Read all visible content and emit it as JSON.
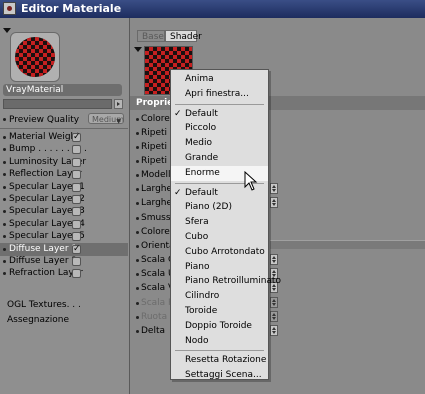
{
  "window": {
    "title": "Editor Materiale"
  },
  "left_panel": {
    "material_name": "VrayMaterial",
    "preview_quality_label": "Preview Quality",
    "preview_quality_value": "Medium",
    "channels": [
      {
        "label": "Material Weight",
        "checked": true,
        "checked_mark": "✓"
      },
      {
        "label": "Bump . . . . . . . . .",
        "checked": false
      },
      {
        "label": "Luminosity Layer",
        "checked": false
      },
      {
        "label": "Reflection Layer",
        "checked": false
      },
      {
        "label": "Specular Layer 1",
        "checked": false
      },
      {
        "label": "Specular Layer 2",
        "checked": false
      },
      {
        "label": "Specular Layer 3",
        "checked": false
      },
      {
        "label": "Specular Layer 4",
        "checked": false
      },
      {
        "label": "Specular Layer 5",
        "checked": false
      },
      {
        "label": "Diffuse Layer 1",
        "checked": true,
        "checked_mark": "✓",
        "selected": true
      },
      {
        "label": "Diffuse Layer 2",
        "checked": false
      },
      {
        "label": "Refraction Layer",
        "checked": false
      }
    ],
    "extra_items": [
      "OGL Textures. . .",
      "Assegnazione"
    ]
  },
  "right_panel": {
    "tabs": [
      {
        "label": "Base",
        "active": false
      },
      {
        "label": "Shader",
        "active": true
      }
    ],
    "properties_header": "Propriet",
    "properties": [
      {
        "label": "Colore S"
      },
      {
        "label": "Ripeti C"
      },
      {
        "label": "Ripeti C"
      },
      {
        "label": "Ripeti C"
      },
      {
        "label": "Modello"
      },
      {
        "label": "Larghez"
      },
      {
        "label": "Larghez"
      },
      {
        "label": "Smussa"
      },
      {
        "label": "Colore C"
      },
      {
        "label": "Orientar"
      },
      {
        "label": "Scala G"
      },
      {
        "label": "Scala U"
      },
      {
        "label": "Scala V"
      },
      {
        "label": "Scala R",
        "disabled": true
      },
      {
        "label": "Ruota",
        "disabled": true
      },
      {
        "label": "Delta"
      }
    ]
  },
  "context_menu": {
    "items": [
      {
        "label": "Anima"
      },
      {
        "label": "Apri finestra..."
      },
      {
        "separator": true
      },
      {
        "label": "Default",
        "checked": true
      },
      {
        "label": "Piccolo"
      },
      {
        "label": "Medio"
      },
      {
        "label": "Grande"
      },
      {
        "label": "Enorme",
        "highlighted": true
      },
      {
        "separator": true
      },
      {
        "label": "Default",
        "checked": true
      },
      {
        "label": "Piano (2D)"
      },
      {
        "label": "Sfera"
      },
      {
        "label": "Cubo"
      },
      {
        "label": "Cubo Arrotondato"
      },
      {
        "label": "Piano"
      },
      {
        "label": "Piano Retroilluminato"
      },
      {
        "label": "Cilindro"
      },
      {
        "label": "Toroide"
      },
      {
        "label": "Doppio Toroide"
      },
      {
        "label": "Nodo"
      },
      {
        "separator": true
      },
      {
        "label": "Resetta Rotazione"
      },
      {
        "label": "Settaggi Scena..."
      }
    ],
    "check_glyph": "✓"
  },
  "colors": {
    "title_bar": "#1d2c5e",
    "checker_red": "#c62020",
    "checker_dark": "#1a1010",
    "selection": "#6f6f6f",
    "menu_bg": "#dedede"
  }
}
